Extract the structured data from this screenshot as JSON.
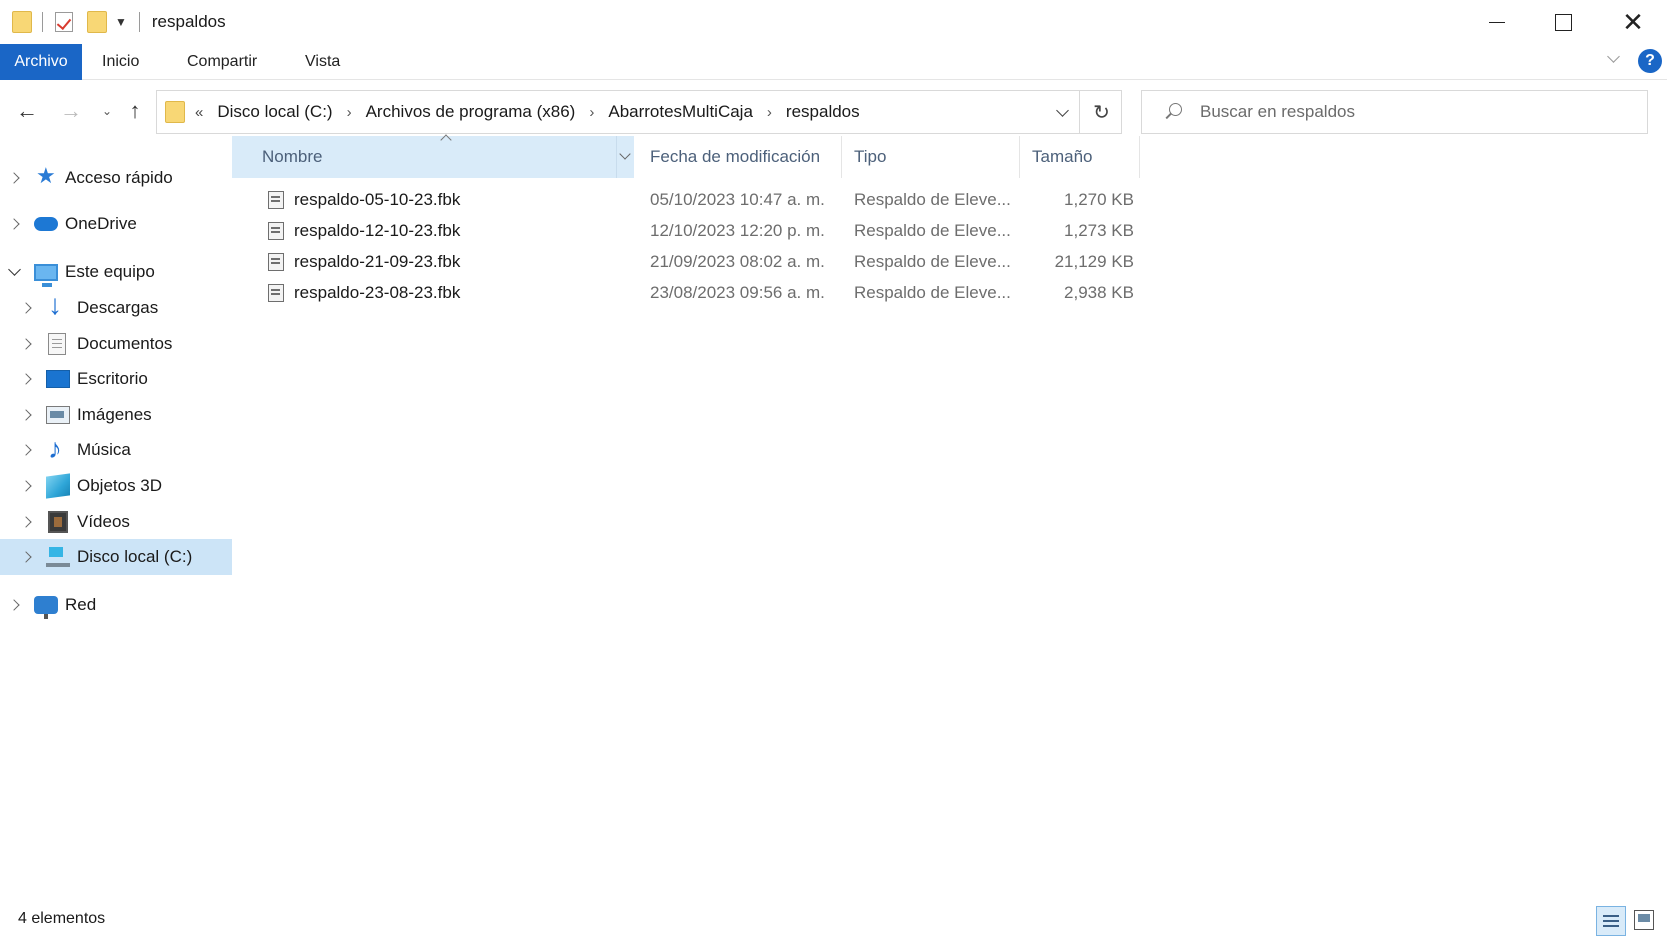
{
  "window": {
    "title": "respaldos",
    "close_glyph": "✕"
  },
  "ribbon": {
    "tabs": [
      "Archivo",
      "Inicio",
      "Compartir",
      "Vista"
    ],
    "help_glyph": "?"
  },
  "nav": {
    "back_glyph": "←",
    "forward_glyph": "→",
    "up_glyph": "↑",
    "recent_glyph": "⌄",
    "refresh_glyph": "↻",
    "breadcrumb_lead": "«",
    "breadcrumb_sep": "›",
    "breadcrumb": [
      "Disco local (C:)",
      "Archivos de programa (x86)",
      "AbarrotesMultiCaja",
      "respaldos"
    ]
  },
  "search": {
    "placeholder": "Buscar en respaldos",
    "value": ""
  },
  "sidebar": {
    "items": [
      {
        "label": "Acceso rápido",
        "icon": "star-icon"
      },
      {
        "label": "OneDrive",
        "icon": "cloud-icon"
      },
      {
        "label": "Este equipo",
        "icon": "computer-icon"
      },
      {
        "label": "Descargas",
        "icon": "download-icon"
      },
      {
        "label": "Documentos",
        "icon": "document-icon"
      },
      {
        "label": "Escritorio",
        "icon": "desktop-icon"
      },
      {
        "label": "Imágenes",
        "icon": "pictures-icon"
      },
      {
        "label": "Música",
        "icon": "music-icon"
      },
      {
        "label": "Objetos 3D",
        "icon": "objects-3d-icon"
      },
      {
        "label": "Vídeos",
        "icon": "videos-icon"
      },
      {
        "label": "Disco local (C:)",
        "icon": "drive-icon",
        "selected": true
      },
      {
        "label": "Red",
        "icon": "network-icon"
      }
    ]
  },
  "filelist": {
    "columns": [
      "Nombre",
      "Fecha de modificación",
      "Tipo",
      "Tamaño"
    ],
    "sorted_column": "Nombre",
    "rows": [
      {
        "name": "respaldo-05-10-23.fbk",
        "date": "05/10/2023 10:47 a. m.",
        "type": "Respaldo de Eleve...",
        "size": "1,270 KB"
      },
      {
        "name": "respaldo-12-10-23.fbk",
        "date": "12/10/2023 12:20 p. m.",
        "type": "Respaldo de Eleve...",
        "size": "1,273 KB"
      },
      {
        "name": "respaldo-21-09-23.fbk",
        "date": "21/09/2023 08:02 a. m.",
        "type": "Respaldo de Eleve...",
        "size": "21,129 KB"
      },
      {
        "name": "respaldo-23-08-23.fbk",
        "date": "23/08/2023 09:56 a. m.",
        "type": "Respaldo de Eleve...",
        "size": "2,938 KB"
      }
    ]
  },
  "status": {
    "count_text": "4 elementos"
  },
  "colors": {
    "accent": "#1a66c6",
    "selection": "#cce4f7",
    "header_sorted": "#d9ebf9"
  }
}
